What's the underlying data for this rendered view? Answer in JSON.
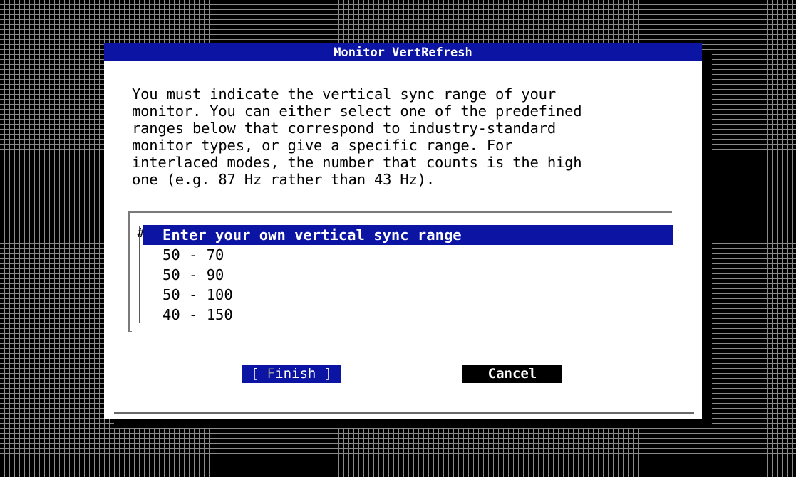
{
  "dialog": {
    "title": "Monitor VertRefresh",
    "description": "You must indicate the vertical sync range of your\nmonitor. You can either select one of the predefined\nranges below that correspond to industry-standard\nmonitor types, or give a specific range. For\ninterlaced modes, the number that counts is the high\none (e.g. 87 Hz rather than 43 Hz).",
    "list": {
      "scroll_marker": "#",
      "items": [
        "Enter your own vertical sync range",
        "50 - 70",
        "50 - 90",
        "50 - 100",
        "40 - 150"
      ],
      "selected_index": 0
    },
    "buttons": {
      "finish_left_bracket": "[ ",
      "finish_hotkey": "F",
      "finish_rest": "inish ]",
      "cancel": "Cancel"
    }
  },
  "colors": {
    "title_bar": "#0c14a3",
    "selection": "#0c14a3",
    "background_grid": "#8a8a8a",
    "dialog": "#ffffff"
  }
}
